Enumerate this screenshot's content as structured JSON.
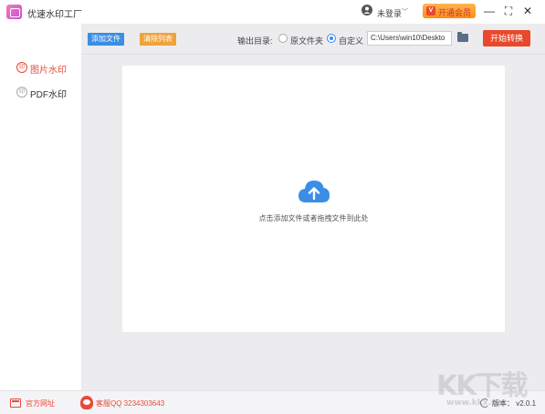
{
  "titlebar": {
    "app_title": "优速水印工厂",
    "login_label": "未登录",
    "login_arrow": "﹀",
    "vip_label": "开通会员",
    "vip_mark": "V",
    "min_glyph": "—",
    "max_glyph": "⛶",
    "close_glyph": "✕"
  },
  "sidebar": {
    "items": [
      {
        "label": "图片水印",
        "icon": "印",
        "active": true
      },
      {
        "label": "PDF水印",
        "icon": "印",
        "active": false
      }
    ]
  },
  "toolbar": {
    "add_label": "添加文件",
    "clear_label": "清除列表",
    "output_label": "输出目录:",
    "radio_original": "原文件夹",
    "radio_custom": "自定义",
    "path_value": "C:\\Users\\win10\\Deskto",
    "start_label": "开始转换"
  },
  "dropzone": {
    "hint": "点击添加文件或者拖拽文件到此处"
  },
  "bottombar": {
    "site_label": "官方网址",
    "qq_label": "客服QQ 3234303643",
    "version_label": "版本：  v2.0.1"
  },
  "watermark": {
    "text": "KK下载",
    "sub": "www.kkx.net"
  },
  "colors": {
    "accent_red": "#e8482b",
    "accent_blue": "#3a8ee6",
    "accent_orange": "#f0a33a"
  }
}
